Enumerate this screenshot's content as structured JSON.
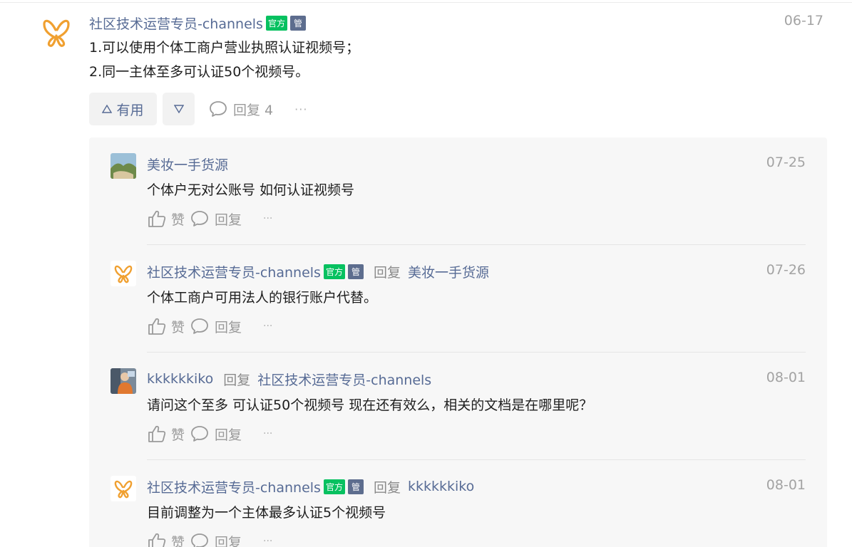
{
  "post": {
    "author": "社区技术运营专员-channels",
    "badge_official": "官方",
    "badge_admin": "管",
    "date": "06-17",
    "lines": [
      "1.可以使用个体工商户营业执照认证视频号；",
      "2.同一主体至多可认证50个视频号。"
    ],
    "useful_label": "有用",
    "reply_label": "回复 4",
    "more_label": "···",
    "avatar_icon": "butterfly-logo-icon"
  },
  "replies": [
    {
      "author": "美妆一手货源",
      "reply_word": "",
      "target": "",
      "date": "07-25",
      "text": "个体户无对公账号 如何认证视频号",
      "like_label": "赞",
      "reply_label": "回复",
      "more_label": "···"
    },
    {
      "author": "社区技术运营专员-channels",
      "badge_official": "官方",
      "badge_admin": "管",
      "reply_word": "回复",
      "target": "美妆一手货源",
      "date": "07-26",
      "text": "个体工商户可用法人的银行账户代替。",
      "like_label": "赞",
      "reply_label": "回复",
      "more_label": "···"
    },
    {
      "author": "kkkkkkiko",
      "reply_word": "回复",
      "target": "社区技术运营专员-channels",
      "date": "08-01",
      "text": "请问这个至多 可认证50个视频号 现在还有效么，相关的文档是在哪里呢？",
      "like_label": "赞",
      "reply_label": "回复",
      "more_label": "···"
    },
    {
      "author": "社区技术运营专员-channels",
      "badge_official": "官方",
      "badge_admin": "管",
      "reply_word": "回复",
      "target": "kkkkkkiko",
      "date": "08-01",
      "text": "目前调整为一个主体最多认证5个视频号",
      "like_label": "赞",
      "reply_label": "回复",
      "more_label": "···"
    }
  ],
  "colors": {
    "link": "#576b95",
    "official_badge": "#07c160",
    "admin_badge": "#5d6d8e",
    "logo": "#f0a030"
  }
}
